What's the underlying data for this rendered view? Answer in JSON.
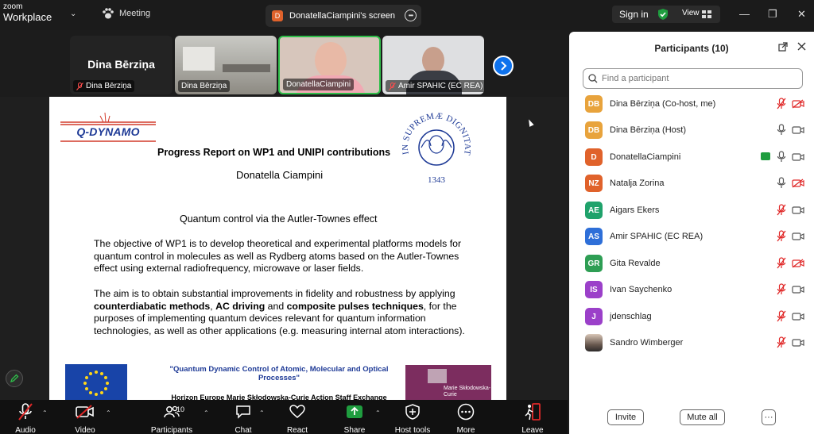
{
  "app": {
    "logo_line1": "zoom",
    "logo_line2": "Workplace"
  },
  "titlebar": {
    "meeting_label": "Meeting",
    "share_tab_avatar": "D",
    "share_tab_label": "DonatellaCiampini's screen",
    "signin_label": "Sign in",
    "view_label": "View"
  },
  "thumbnails": [
    {
      "name": "Dina Bērziņa",
      "big_name": "Dina Bērziņa",
      "muted": true
    },
    {
      "name": "Dina Bērziņa",
      "muted": false
    },
    {
      "name": "DonatellaCiampini",
      "muted": false,
      "active": true
    },
    {
      "name": "Amir SPAHIC (EC REA)",
      "muted": true
    }
  ],
  "slide": {
    "logo_text": "Q-DYNAMO",
    "title": "Progress Report on WP1 and UNIPI contributions",
    "author": "Donatella Ciampini",
    "subtitle": "Quantum control via the Autler-Townes effect",
    "para1": "The objective of WP1 is to develop theoretical and experimental platforms models for quantum control in molecules as well as Rydberg atoms based on the Autler-Townes effect using external radiofrequency, microwave or laser fields.",
    "para2_a": "The aim is to obtain substantial improvements in fidelity and robustness by applying ",
    "para2_b": "counterdiabatic methods",
    "para2_c": ", ",
    "para2_d": "AC driving",
    "para2_e": " and ",
    "para2_f": "composite pulses techniques",
    "para2_g": ", for the purposes of implementing quantum devices relevant for quantum information technologies, as well as other applications (e.g. measuring internal atom interactions).",
    "seal_text": "IN SUPREMÆ DIGNITATIS",
    "seal_year": "1343",
    "footer_title": "\"Quantum Dynamic Control of Atomic, Molecular and Optical Processes\"",
    "footer_sub": "Horizon Europe Marie Skłodowska-Curie Action Staff Exchange",
    "msca_text": "Marie Skłodowska-Curie"
  },
  "toolbar": {
    "audio": "Audio",
    "video": "Video",
    "participants": "Participants",
    "participants_count": "10",
    "chat": "Chat",
    "react": "React",
    "share": "Share",
    "host_tools": "Host tools",
    "more": "More",
    "leave": "Leave"
  },
  "panel": {
    "title": "Participants (10)",
    "search_placeholder": "Find a participant",
    "participants": [
      {
        "initials": "DB",
        "name": "Dina Bērziņa (Co-host, me)",
        "color": "#e8a33c",
        "mic": "muted",
        "cam": "off"
      },
      {
        "initials": "DB",
        "name": "Dina Bērziņa (Host)",
        "color": "#e8a33c",
        "mic": "on",
        "cam": "on"
      },
      {
        "initials": "D",
        "name": "DonatellaCiampini",
        "color": "#e0622b",
        "mic": "on",
        "cam": "on",
        "sharing": true
      },
      {
        "initials": "NZ",
        "name": "Natalja Zorina",
        "color": "#e0622b",
        "mic": "on",
        "cam": "off"
      },
      {
        "initials": "AE",
        "name": "Aigars Ekers",
        "color": "#1fa26b",
        "mic": "muted",
        "cam": "on"
      },
      {
        "initials": "AS",
        "name": "Amir SPAHIC (EC REA)",
        "color": "#2e6fd8",
        "mic": "muted",
        "cam": "on"
      },
      {
        "initials": "GR",
        "name": "Gita Revalde",
        "color": "#2e9e54",
        "mic": "muted",
        "cam": "off"
      },
      {
        "initials": "IS",
        "name": "Ivan Saychenko",
        "color": "#9b40c9",
        "mic": "muted",
        "cam": "on"
      },
      {
        "initials": "J",
        "name": "jdenschlag",
        "color": "#9b40c9",
        "mic": "muted",
        "cam": "on"
      },
      {
        "initials": "",
        "name": "Sandro Wimberger",
        "color": "#6a5a50",
        "mic": "muted",
        "cam": "on",
        "photo": true
      }
    ],
    "invite_label": "Invite",
    "mute_all_label": "Mute all",
    "more_label": "···"
  },
  "colors": {
    "accent_blue": "#0e72ed",
    "share_green": "#1f9d3f",
    "leave_red": "#e02828",
    "muted_red": "#e02828"
  }
}
